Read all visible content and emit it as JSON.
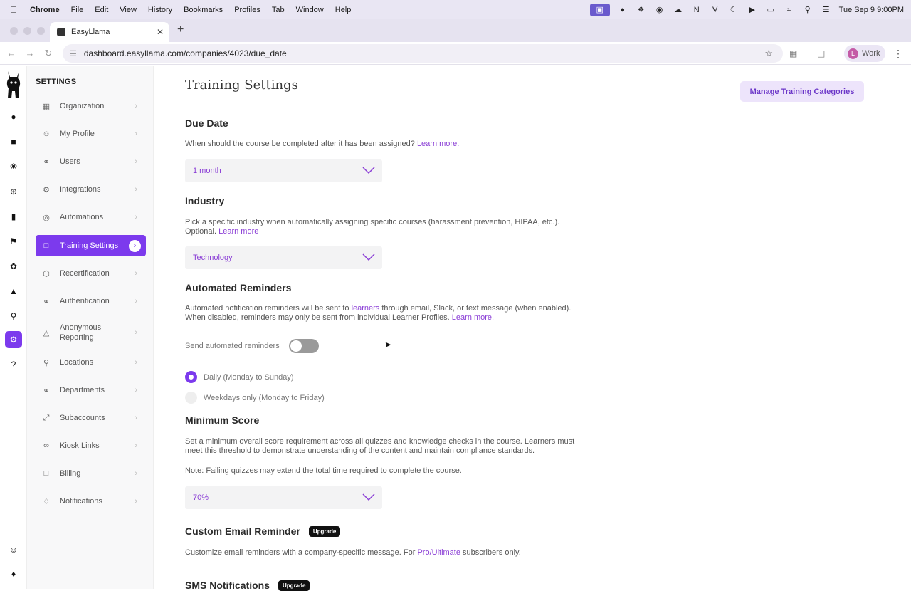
{
  "menubar": {
    "app": "Chrome",
    "items": [
      "File",
      "Edit",
      "View",
      "History",
      "Bookmarks",
      "Profiles",
      "Tab",
      "Window",
      "Help"
    ],
    "clock": "Tue Sep 9  9:00PM"
  },
  "browser": {
    "tab_title": "EasyLlama",
    "url": "dashboard.easyllama.com/companies/4023/due_date",
    "profile_label": "Work",
    "profile_initial": "L"
  },
  "sidebar": {
    "title": "SETTINGS",
    "items": [
      {
        "label": "Organization",
        "icon": "building-icon"
      },
      {
        "label": "My Profile",
        "icon": "user-plus-icon"
      },
      {
        "label": "Users",
        "icon": "users-icon"
      },
      {
        "label": "Integrations",
        "icon": "gear-icon"
      },
      {
        "label": "Automations",
        "icon": "target-icon"
      },
      {
        "label": "Training Settings",
        "icon": "document-icon",
        "active": true
      },
      {
        "label": "Recertification",
        "icon": "cube-icon"
      },
      {
        "label": "Authentication",
        "icon": "users-icon"
      },
      {
        "label": "Anonymous Reporting",
        "icon": "warning-icon"
      },
      {
        "label": "Locations",
        "icon": "pin-icon"
      },
      {
        "label": "Departments",
        "icon": "users-icon"
      },
      {
        "label": "Subaccounts",
        "icon": "arrows-icon"
      },
      {
        "label": "Kiosk Links",
        "icon": "link-icon"
      },
      {
        "label": "Billing",
        "icon": "document-icon"
      },
      {
        "label": "Notifications",
        "icon": "bell-icon"
      }
    ]
  },
  "page": {
    "title": "Training Settings",
    "manage_button": "Manage Training Categories"
  },
  "due_date": {
    "heading": "Due Date",
    "desc": "When should the course be completed after it has been assigned?",
    "learn_more": "Learn more.",
    "value": "1 month"
  },
  "industry": {
    "heading": "Industry",
    "desc_line1": "Pick a specific industry when automatically assigning specific courses (harassment prevention, HIPAA, etc.).",
    "desc_line2": "Optional.",
    "learn_more": "Learn more",
    "value": "Technology"
  },
  "reminders": {
    "heading": "Automated Reminders",
    "desc_a": "Automated notification reminders will be sent to ",
    "desc_link": "learners",
    "desc_b": " through email, Slack, or text message (when enabled).",
    "desc_line2": "When disabled, reminders may only be sent from individual Learner Profiles.",
    "learn_more": "Learn more.",
    "toggle_label": "Send automated reminders",
    "toggle_on": false,
    "option_daily": "Daily (Monday to Sunday)",
    "option_weekdays": "Weekdays only (Monday to Friday)"
  },
  "min_score": {
    "heading": "Minimum Score",
    "desc_line1": "Set a minimum overall score requirement across all quizzes and knowledge checks in the course. Learners must",
    "desc_line2": "meet this threshold to demonstrate understanding of the content and maintain compliance standards.",
    "note": "Note: Failing quizzes may extend the total time required to complete the course.",
    "value": "70%"
  },
  "custom_email": {
    "heading": "Custom Email Reminder",
    "badge": "Upgrade",
    "desc_a": "Customize email reminders with a company-specific message. For ",
    "desc_link": "Pro/Ultimate",
    "desc_b": " subscribers only."
  },
  "sms": {
    "heading": "SMS Notifications",
    "badge": "Upgrade"
  },
  "colors": {
    "accent": "#7c3aed",
    "link": "#8b3fd6",
    "manage_bg": "#ede4fb"
  }
}
